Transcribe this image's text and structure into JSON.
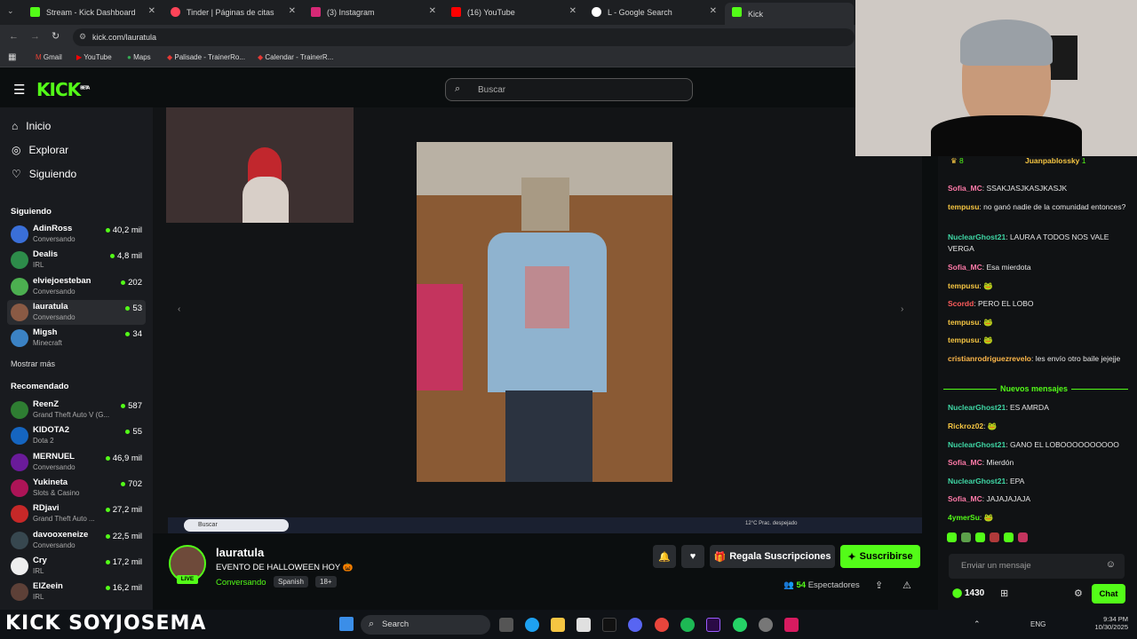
{
  "tabs": [
    {
      "title": "Stream - Kick Dashboard",
      "color": "#53fc18"
    },
    {
      "title": "Tinder | Páginas de citas",
      "color": "#ff4458"
    },
    {
      "title": "(3) Instagram",
      "color": "#d62976"
    },
    {
      "title": "(16) YouTube",
      "color": "#ff0000"
    },
    {
      "title": "L - Google Search",
      "color": "#ffffff"
    },
    {
      "title": "Kick",
      "color": "#53fc18"
    }
  ],
  "url": "kick.com/lauratula",
  "bookmarks": [
    "Gmail",
    "YouTube",
    "Maps",
    "Palisade - TrainerRo...",
    "Calendar - TrainerR..."
  ],
  "header": {
    "logo": "KICK",
    "beta": "BETA",
    "search_placeholder": "Buscar"
  },
  "nav": {
    "home": "Inicio",
    "explore": "Explorar",
    "following": "Siguiendo"
  },
  "sections": {
    "following": "Siguiendo",
    "show_more": "Mostrar más",
    "recommended": "Recomendado"
  },
  "following": [
    {
      "name": "AdinRoss",
      "cat": "Conversando",
      "viewers": "40,2 mil",
      "color": "#3a6fd8"
    },
    {
      "name": "Dealis",
      "cat": "IRL",
      "viewers": "4,8 mil",
      "color": "#2d8c4a"
    },
    {
      "name": "elviejoesteban",
      "cat": "Conversando",
      "viewers": "202",
      "color": "#4caf50"
    },
    {
      "name": "lauratula",
      "cat": "Conversando",
      "viewers": "53",
      "color": "#8a5a44"
    },
    {
      "name": "Migsh",
      "cat": "Minecraft",
      "viewers": "34",
      "color": "#3b82c4"
    }
  ],
  "recommended": [
    {
      "name": "ReenZ",
      "cat": "Grand Theft Auto V (G...",
      "viewers": "587",
      "color": "#2e7d32"
    },
    {
      "name": "KIDOTA2",
      "cat": "Dota 2",
      "viewers": "55",
      "color": "#1565c0"
    },
    {
      "name": "MERNUEL",
      "cat": "Conversando",
      "viewers": "46,9 mil",
      "color": "#6a1b9a"
    },
    {
      "name": "Yukineta",
      "cat": "Slots & Casino",
      "viewers": "702",
      "color": "#ad1457"
    },
    {
      "name": "RDjavi",
      "cat": "Grand Theft Auto ...",
      "viewers": "27,2 mil",
      "color": "#c62828"
    },
    {
      "name": "davooxeneize",
      "cat": "Conversando",
      "viewers": "22,5 mil",
      "color": "#37474f"
    },
    {
      "name": "Cry",
      "cat": "IRL",
      "viewers": "17,2 mil",
      "color": "#eeeeee"
    },
    {
      "name": "ElZeein",
      "cat": "IRL",
      "viewers": "16,2 mil",
      "color": "#5d4037"
    }
  ],
  "stream": {
    "name": "lauratula",
    "live": "LIVE",
    "title": "EVENTO DE HALLOWEEN HOY 🎃",
    "category": "Conversando",
    "tags": [
      "Spanish",
      "18+"
    ],
    "viewers": "54",
    "viewers_label": "Espectadores",
    "gift": "Regala Suscripciones",
    "subscribe": "Suscribirse"
  },
  "inner_taskbar": {
    "search": "Buscar",
    "weather": "12°C  Prac. despejado"
  },
  "chat": {
    "top": {
      "left_count": "8",
      "user": "Juanpablossky",
      "right_count": "1"
    },
    "messages": [
      {
        "user": "Sofia_MC",
        "color": "#ff7aa8",
        "text": "SSAKJASJKASJKASJK"
      },
      {
        "user": "tempusu",
        "color": "#f5c542",
        "text": "no ganó nadie de la comunidad entonces?"
      },
      {
        "user": "NuclearGhost21",
        "color": "#3fd7a5",
        "text": "LAURA A TODOS NOS VALE VERGA"
      },
      {
        "user": "Sofia_MC",
        "color": "#ff7aa8",
        "text": "Esa mierdota"
      },
      {
        "user": "tempusu",
        "color": "#f5c542",
        "text": "🐸"
      },
      {
        "user": "Scordd",
        "color": "#ff5c5c",
        "text": "PERO EL LOBO"
      },
      {
        "user": "tempusu",
        "color": "#f5c542",
        "text": "🐸"
      },
      {
        "user": "tempusu",
        "color": "#f5c542",
        "text": "🐸"
      },
      {
        "user": "cristianrodriguezrevelo",
        "color": "#ffb84a",
        "text": "les envío otro baile jejejje"
      }
    ],
    "new_messages": "Nuevos mensajes",
    "messages2": [
      {
        "user": "NuclearGhost21",
        "color": "#3fd7a5",
        "text": "ES AMRDA"
      },
      {
        "user": "Rickroz02",
        "color": "#f5c542",
        "text": "🐸"
      },
      {
        "user": "NuclearGhost21",
        "color": "#3fd7a5",
        "text": "GANO EL LOBOOOOOOOOOO"
      },
      {
        "user": "Sofia_MC",
        "color": "#ff7aa8",
        "text": "Mierdón"
      },
      {
        "user": "NuclearGhost21",
        "color": "#3fd7a5",
        "text": "EPA"
      },
      {
        "user": "Sofia_MC",
        "color": "#ff7aa8",
        "text": "JAJAJAJAJA"
      },
      {
        "user": "4ymerSu",
        "color": "#53fc18",
        "text": "🐸"
      }
    ],
    "input_placeholder": "Enviar un mensaje",
    "points": "1430",
    "send": "Chat"
  },
  "overlay": {
    "banner": "KICK SOYJOSEMA"
  },
  "taskbar": {
    "search": "Search",
    "lang": "ENG",
    "time": "9:34 PM",
    "date": "10/30/2025"
  },
  "colors": {
    "kick_green": "#53fc18",
    "bg": "#0b0e0f"
  }
}
